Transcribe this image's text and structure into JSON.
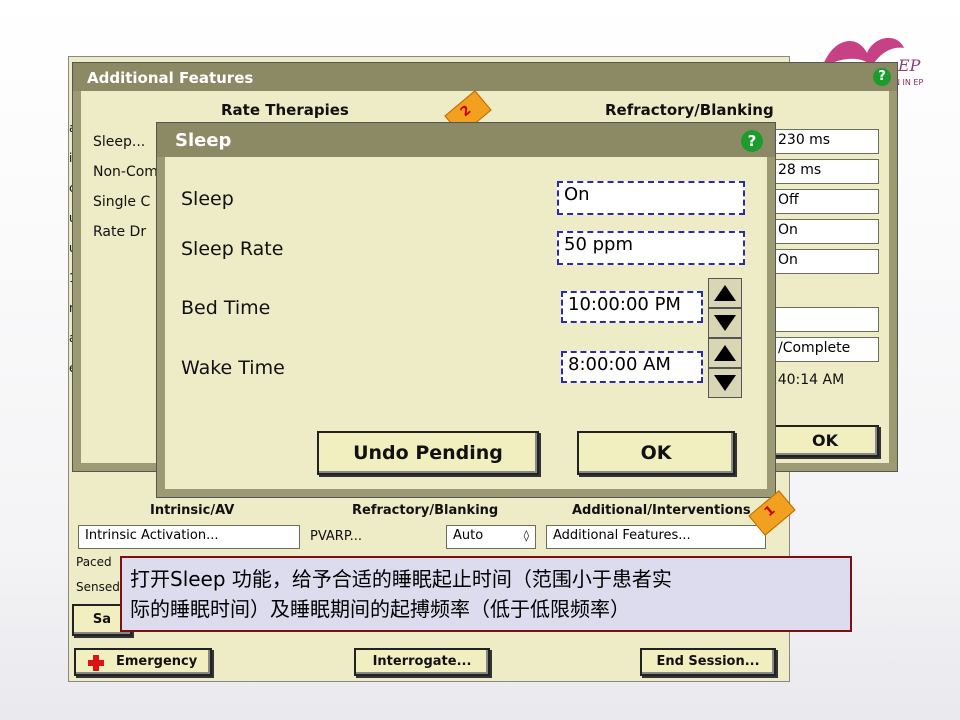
{
  "logo": {
    "text": "EP",
    "subtext": "N IN EP"
  },
  "af": {
    "title": "Additional Features",
    "rate_therapies_header": "Rate Therapies",
    "refractory_header": "Refractory/Blanking",
    "left_items": [
      "Sleep...",
      "Non-Com",
      "Single C",
      "Rate Dr"
    ],
    "right_values": [
      "230 ms",
      "28 ms",
      "Off",
      "On",
      "On",
      "",
      "/Complete"
    ],
    "right_time": ":40:14 AM",
    "ok": "OK"
  },
  "bottom": {
    "col1": "Intrinsic/AV",
    "col2": "Refractory/Blanking",
    "col3": "Additional/Interventions",
    "intrinsic_field": "Intrinsic Activation...",
    "pvarp_label": "PVARP...",
    "pvarp_value": "Auto",
    "addl_field": "Additional Features...",
    "paced_label": "Paced",
    "sensed_label": "Sensed",
    "sa_label": "Sa",
    "emergency": "Emergency",
    "interrogate": "Interrogate...",
    "end_session": "End Session..."
  },
  "sleep": {
    "title": "Sleep",
    "rows": [
      {
        "label": "Sleep",
        "value": "On"
      },
      {
        "label": "Sleep Rate",
        "value": "50 ppm"
      },
      {
        "label": "Bed Time",
        "value": "10:00:00 PM"
      },
      {
        "label": "Wake Time",
        "value": "8:00:00 AM"
      }
    ],
    "undo": "Undo Pending",
    "ok": "OK"
  },
  "annotation": {
    "line1": "打开Sleep 功能，给予合适的睡眠起止时间（范围小于患者实",
    "line2": "际的睡眠时间）及睡眠期间的起搏频率（低于低限频率）"
  },
  "callouts": [
    "2",
    "1"
  ],
  "colors": {
    "frame": "#9c9a72",
    "panel": "#eeecc6",
    "titlebar": "#8c8a64",
    "annotation_bg": "#dcdcee",
    "annotation_border": "#7a1010",
    "accent_callout": "#f2a020",
    "emergency_cross": "#dd1111"
  },
  "icons": [
    "help-icon",
    "arrow-up-icon",
    "arrow-down-icon",
    "red-cross-icon",
    "ribbon-logo-icon"
  ]
}
